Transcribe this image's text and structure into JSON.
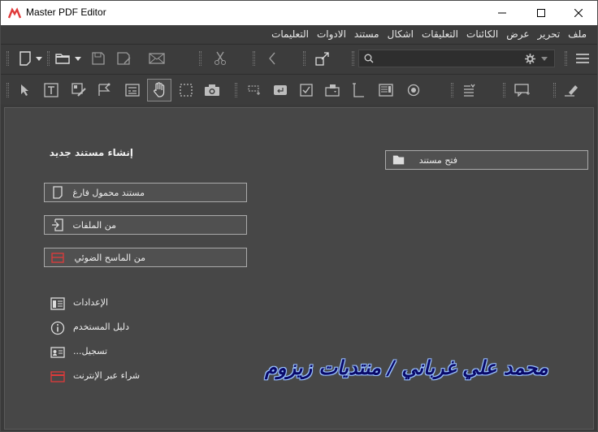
{
  "window": {
    "title": "Master PDF Editor",
    "minimize": "—",
    "maximize": "☐",
    "close": "✕"
  },
  "menu": [
    "ملف",
    "تحرير",
    "عرض",
    "الكائنات",
    "التعليقات",
    "اشكال",
    "مستند",
    "الادوات",
    "التعليمات"
  ],
  "toolbar": {
    "search_value": ""
  },
  "start": {
    "new_heading": "إنشاء مستند جديد",
    "blank_doc": "مستند محمول فارغ",
    "from_files": "من الملفات",
    "from_scanner": "من الماسح الضوئي",
    "open_doc": "فتح مستند"
  },
  "links": {
    "settings": "الإعدادات",
    "user_guide": "دليل المستخدم",
    "register": "تسجيل...",
    "buy_online": "شراء عبر الإنترنت"
  },
  "watermark": "محمد علي غرباني / منتديات زيزوم",
  "colors": {
    "accent_red": "#e03a3a",
    "background": "#474747"
  }
}
